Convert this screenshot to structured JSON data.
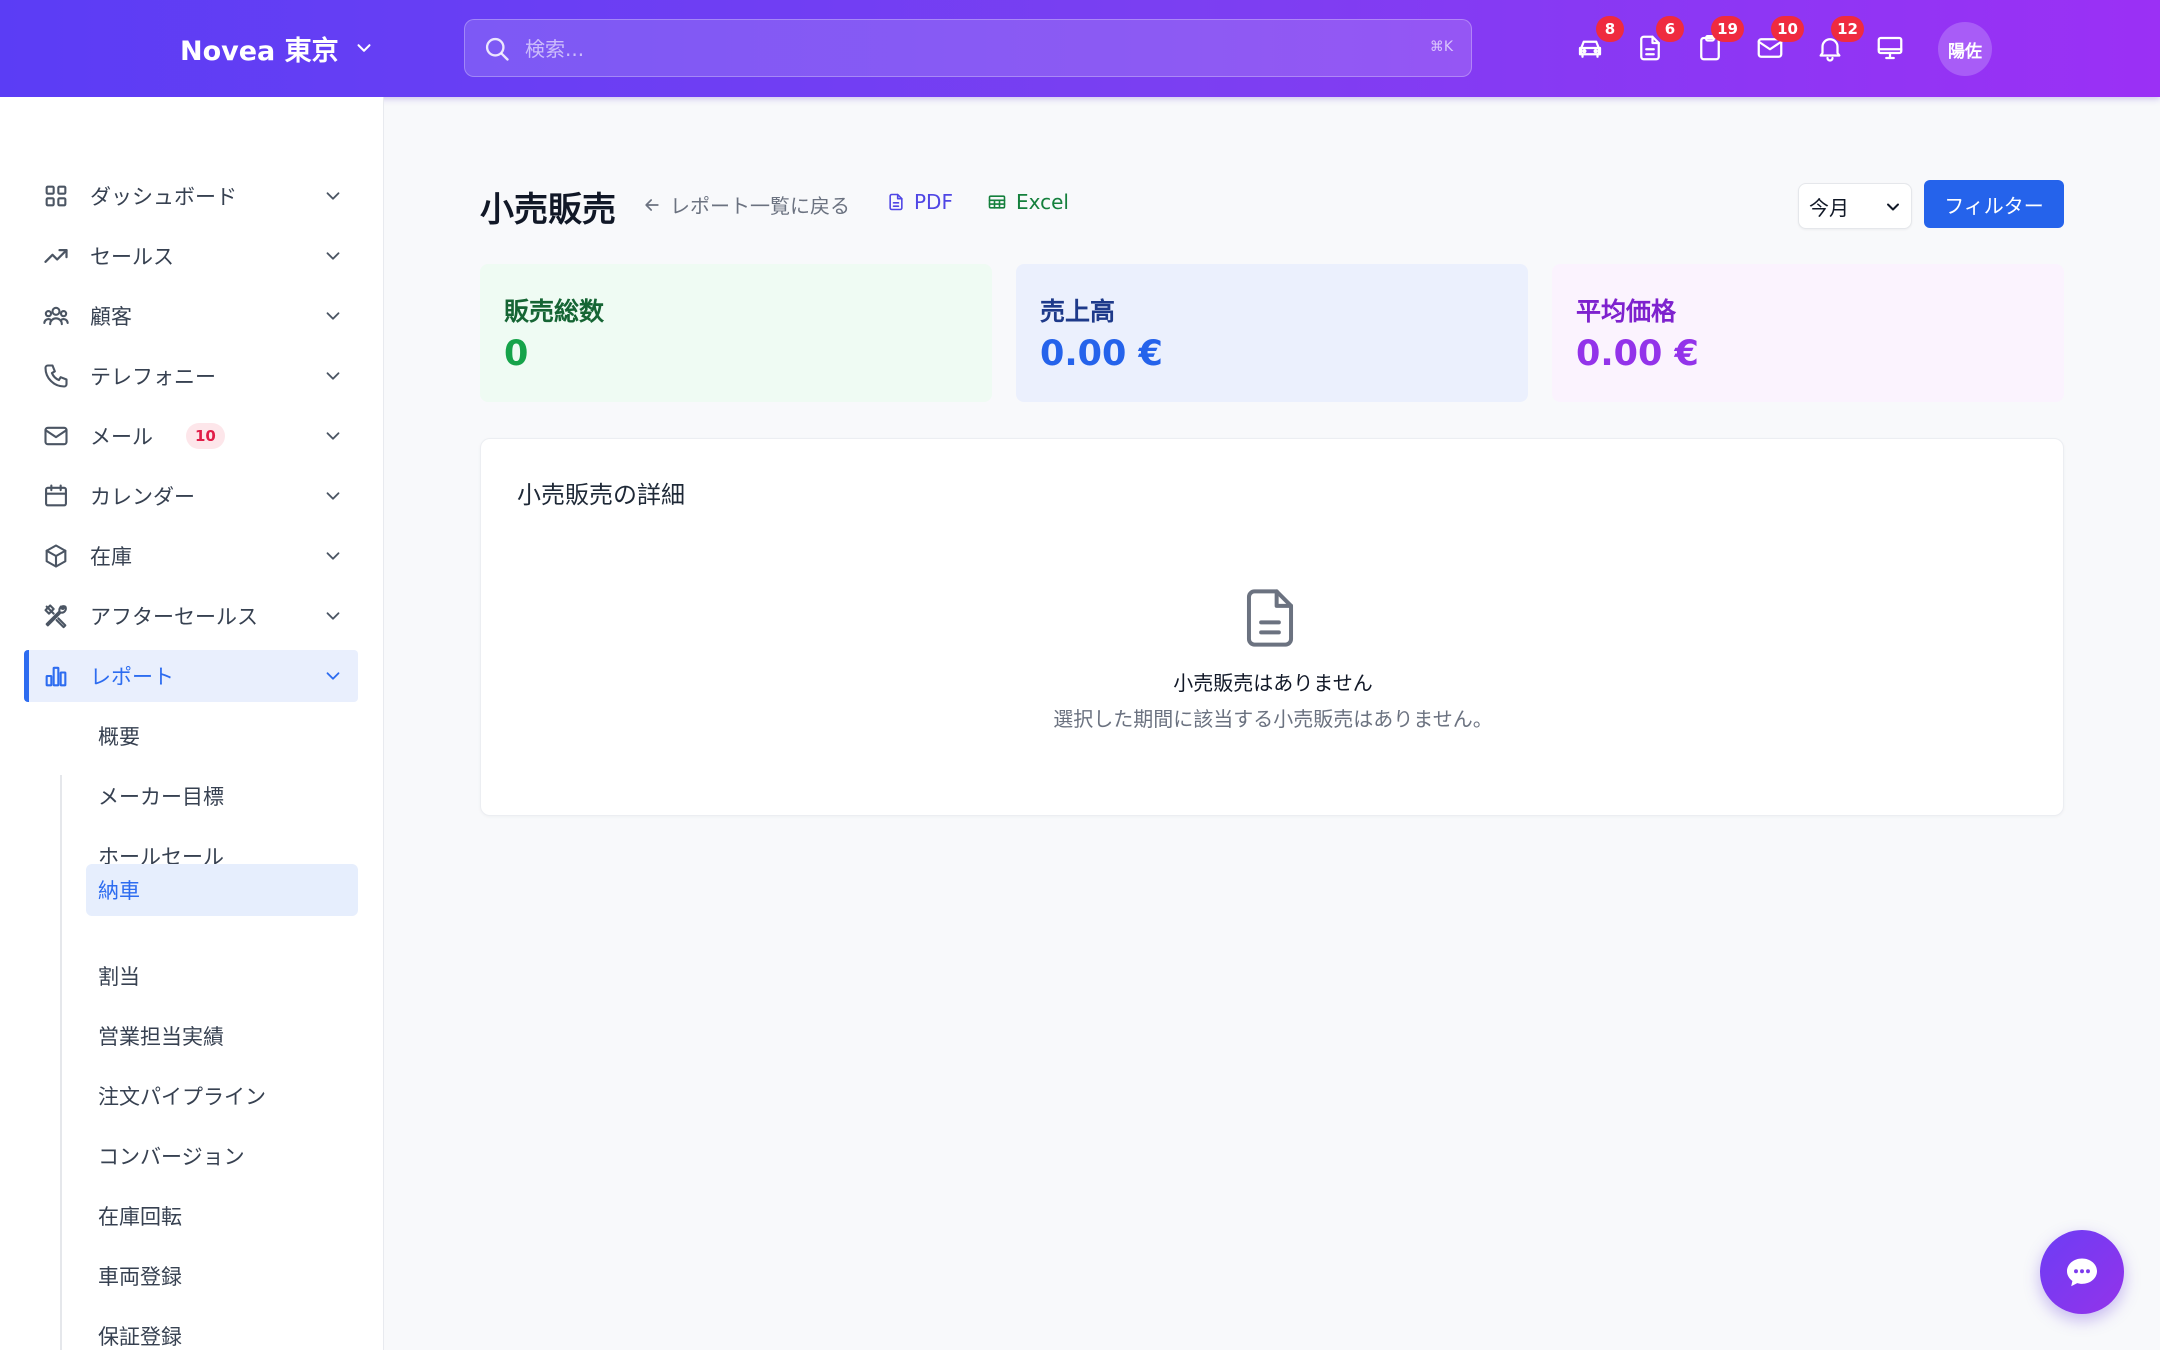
{
  "header": {
    "brand": "Novea 東京",
    "search_placeholder": "検索...",
    "search_shortcut": "⌘K",
    "icons": [
      {
        "name": "car-icon",
        "badge": "8"
      },
      {
        "name": "document-icon",
        "badge": "6"
      },
      {
        "name": "clipboard-icon",
        "badge": "19"
      },
      {
        "name": "mail-icon",
        "badge": "10"
      },
      {
        "name": "bell-icon",
        "badge": "12"
      },
      {
        "name": "monitor-icon",
        "badge": ""
      }
    ],
    "avatar": "陽佐"
  },
  "sidebar": {
    "items": [
      {
        "label": "ダッシュボード",
        "icon": "grid-icon"
      },
      {
        "label": "セールス",
        "icon": "trend-up-icon"
      },
      {
        "label": "顧客",
        "icon": "users-icon"
      },
      {
        "label": "テレフォニー",
        "icon": "phone-icon"
      },
      {
        "label": "メール",
        "icon": "mail-icon",
        "badge": "10"
      },
      {
        "label": "カレンダー",
        "icon": "calendar-icon"
      },
      {
        "label": "在庫",
        "icon": "box-icon"
      },
      {
        "label": "アフターセールス",
        "icon": "tools-icon"
      },
      {
        "label": "レポート",
        "icon": "chart-icon",
        "active": true
      }
    ],
    "sub_items": [
      {
        "label": "概要"
      },
      {
        "label": "メーカー目標"
      },
      {
        "label": "ホールセール"
      },
      {
        "label": "納車",
        "active": true
      },
      {
        "label": "割当"
      },
      {
        "label": "営業担当実績"
      },
      {
        "label": "注文パイプライン"
      },
      {
        "label": "コンバージョン"
      },
      {
        "label": "在庫回転"
      },
      {
        "label": "車両登録"
      },
      {
        "label": "保証登録"
      }
    ]
  },
  "main": {
    "title": "小売販売",
    "back_link": "レポート一覧に戻る",
    "pdf_label": "PDF",
    "excel_label": "Excel",
    "period": "今月",
    "filter_label": "フィルター",
    "stats": [
      {
        "label": "販売総数",
        "value": "0"
      },
      {
        "label": "売上高",
        "value": "0.00 €"
      },
      {
        "label": "平均価格",
        "value": "0.00 €"
      }
    ],
    "detail": {
      "title": "小売販売の詳細",
      "empty_title": "小売販売はありません",
      "empty_desc": "選択した期間に該当する小売販売はありません。"
    }
  },
  "colors": {
    "header_start": "#5b3df5",
    "header_end": "#9b30f5",
    "accent": "#2d6cf0",
    "badge": "#ef2b3f"
  }
}
